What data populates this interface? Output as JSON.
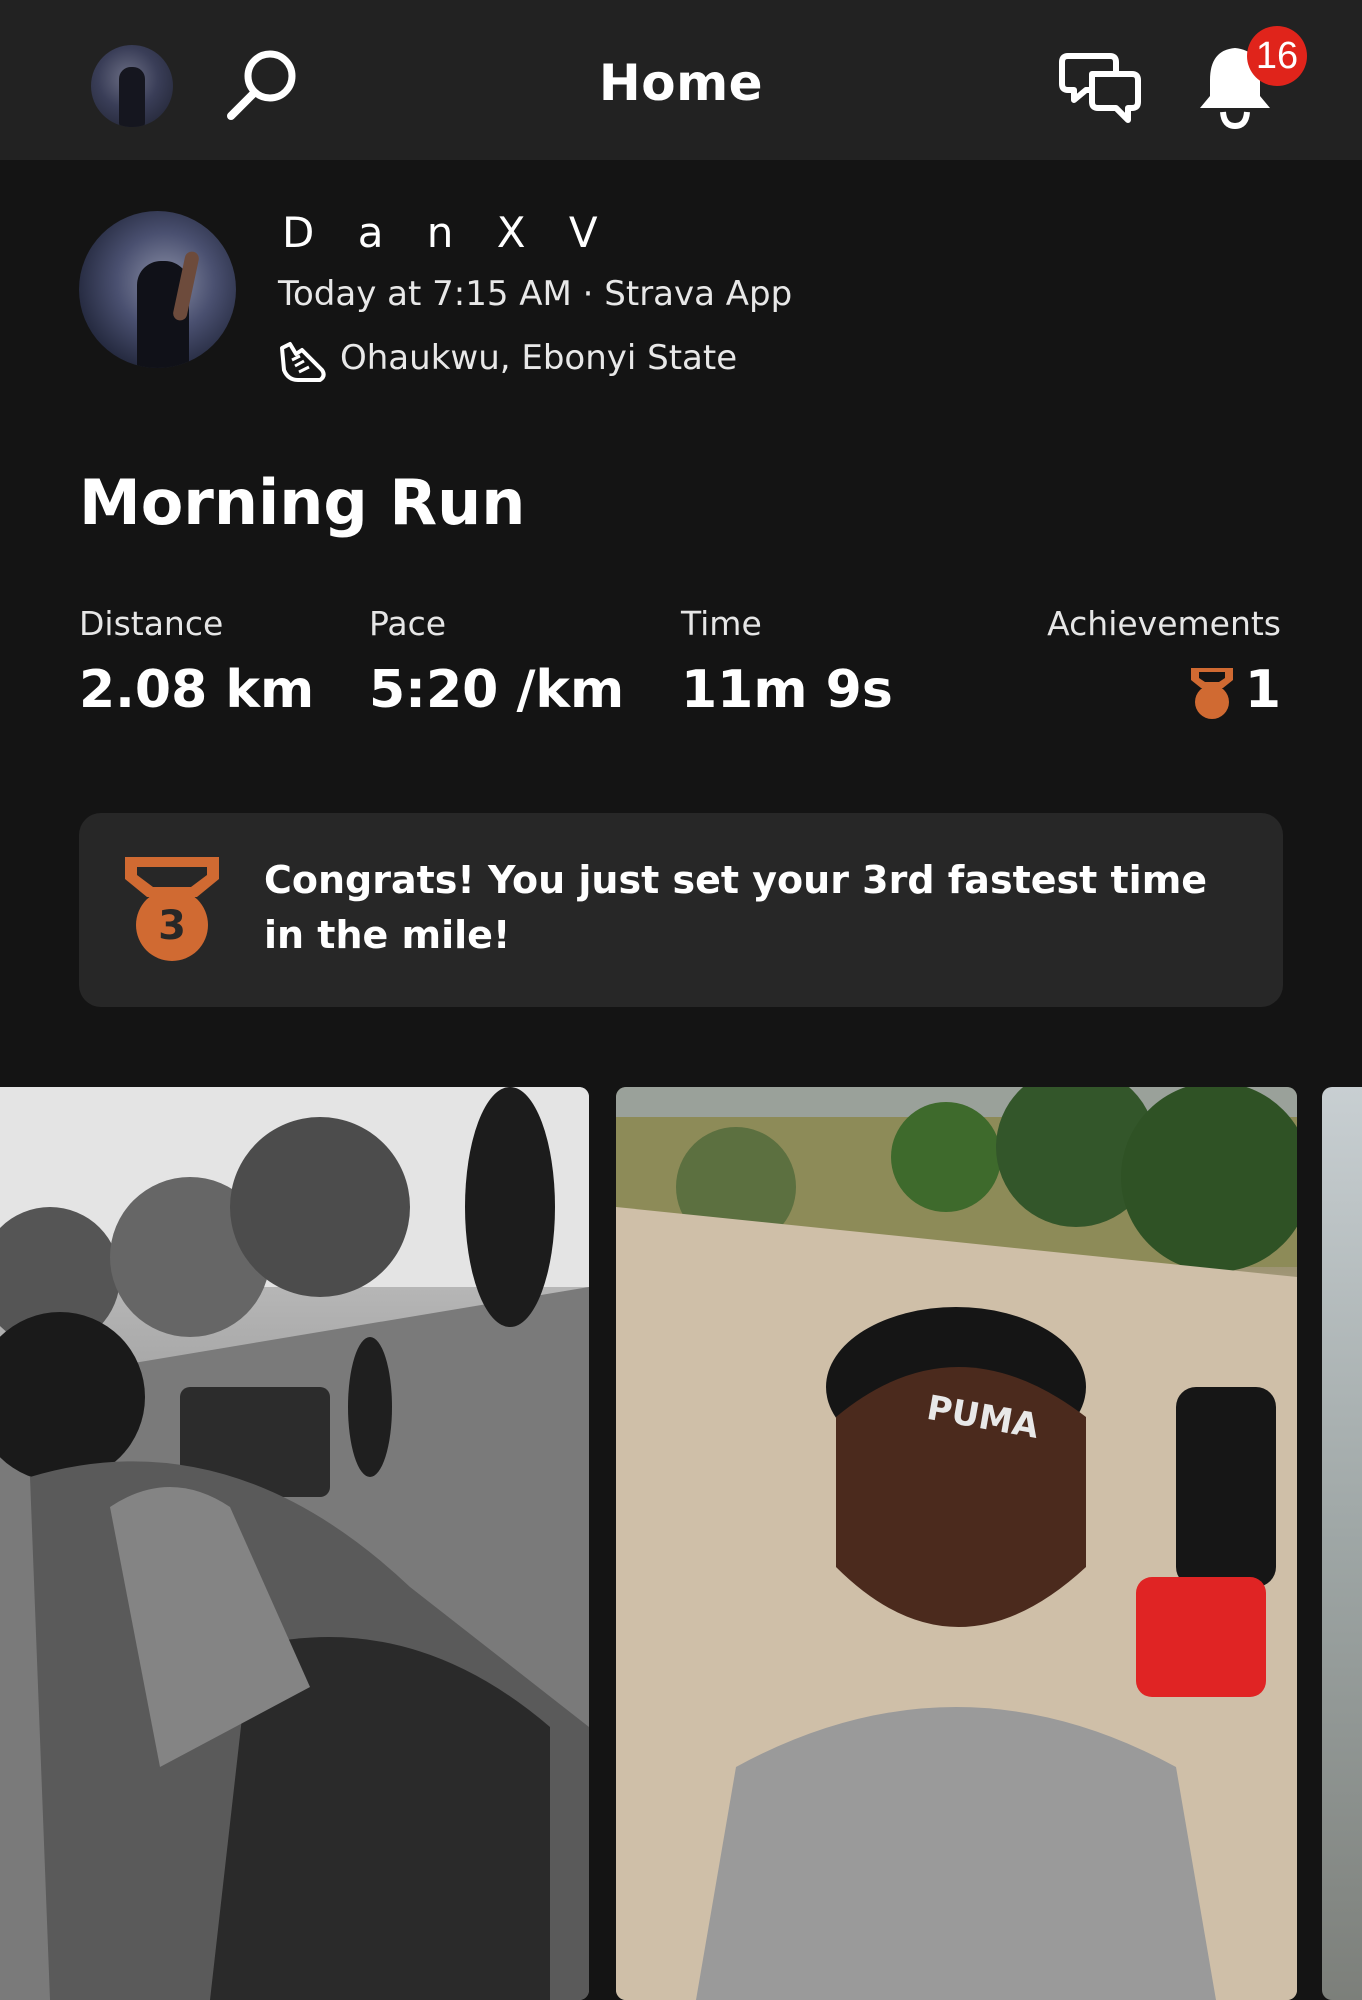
{
  "header": {
    "title": "Home",
    "notification_count": "16"
  },
  "activity": {
    "athlete_name": "D a n X V",
    "meta": "Today at 7:15 AM · Strava App",
    "location": "Ohaukwu, Ebonyi State",
    "title": "Morning Run",
    "stats": {
      "distance_label": "Distance",
      "distance_value": "2.08 km",
      "pace_label": "Pace",
      "pace_value": "5:20 /km",
      "time_label": "Time",
      "time_value": "11m 9s",
      "achievements_label": "Achievements",
      "achievements_value": "1"
    },
    "achievement_message": "Congrats! You just set your 3rd fastest time in the mile!",
    "medal_rank": "3"
  },
  "photo_caption": "PUMA",
  "colors": {
    "background": "#141414",
    "header": "#222222",
    "card": "#272727",
    "badge": "#e0241b",
    "bronze": "#d06a32"
  },
  "icons": [
    "search-icon",
    "chat-icon",
    "bell-icon",
    "shoe-icon",
    "trophy-icon",
    "medal-icon"
  ]
}
